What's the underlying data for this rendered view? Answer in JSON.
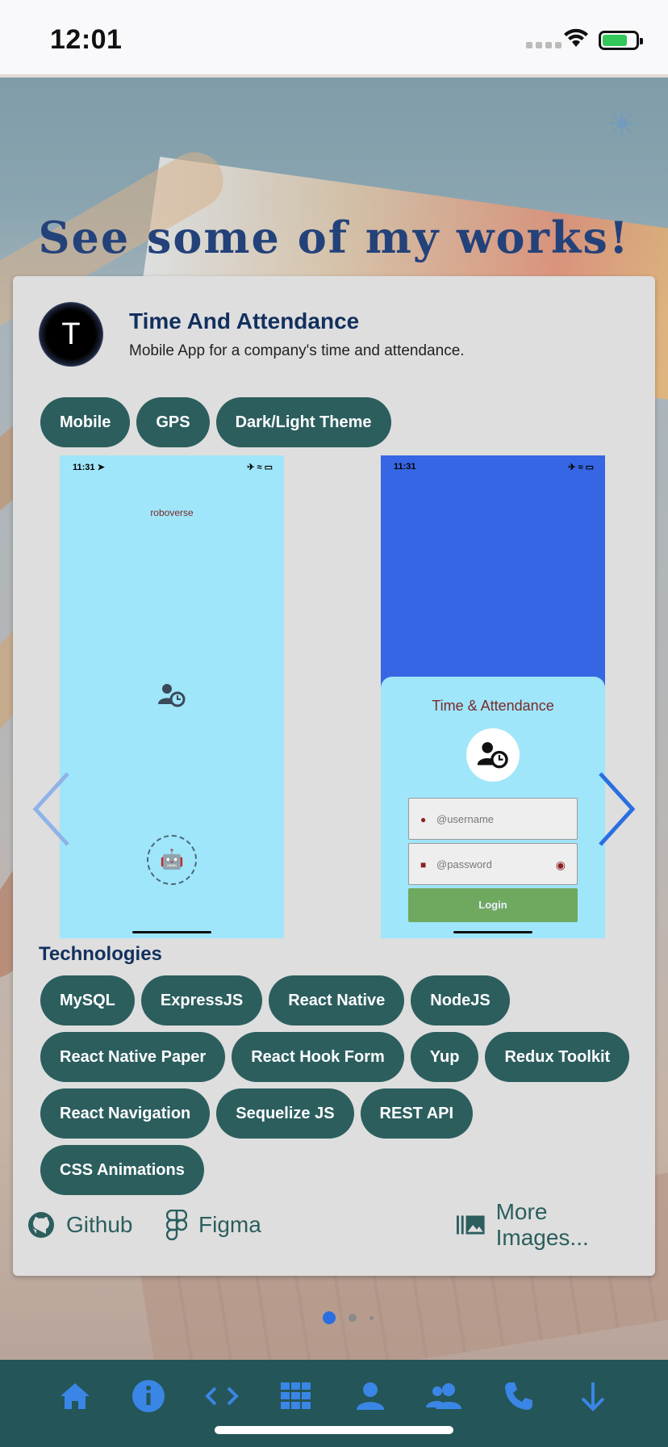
{
  "status_bar": {
    "time": "12:01"
  },
  "header": {
    "headline": "See some of my works!"
  },
  "project": {
    "avatar_letter": "T",
    "title": "Time And Attendance",
    "description": "Mobile App for a company's time and attendance.",
    "tags": [
      "Mobile",
      "GPS",
      "Dark/Light Theme"
    ]
  },
  "carousel": {
    "left_screen": {
      "time": "11:31",
      "brand": "roboverse"
    },
    "right_screen": {
      "time": "11:31",
      "title": "Time & Attendance",
      "username_placeholder": "@username",
      "password_placeholder": "@password",
      "login_label": "Login"
    }
  },
  "technologies": {
    "title": "Technologies",
    "items": [
      "MySQL",
      "ExpressJS",
      "React Native",
      "NodeJS",
      "React Native Paper",
      "React Hook Form",
      "Yup",
      "Redux Toolkit",
      "React Navigation",
      "Sequelize JS",
      "REST API",
      "CSS Animations"
    ]
  },
  "links": {
    "github": "Github",
    "figma": "Figma",
    "more_images": "More Images..."
  },
  "pagination": {
    "current": 1,
    "total": 3
  },
  "nav": {
    "items": [
      "home-icon",
      "info-icon",
      "code-icon",
      "grid-icon",
      "person-icon",
      "people-icon",
      "phone-icon",
      "arrow-down-icon"
    ],
    "color": "#3a86e6",
    "background": "#245558"
  },
  "colors": {
    "chip": "#2c5e5e",
    "heading": "#12305e",
    "accent": "#3a86e6"
  }
}
